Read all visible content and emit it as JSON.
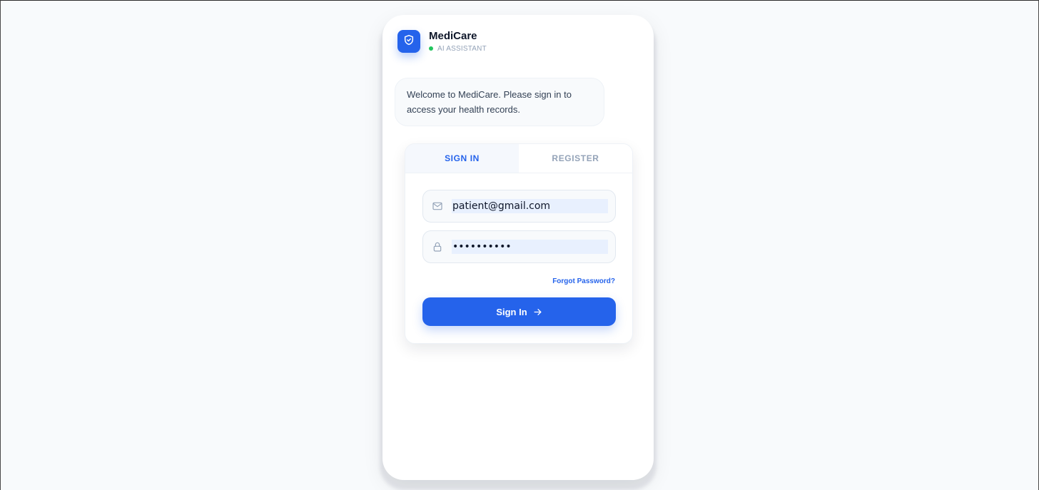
{
  "header": {
    "brand": "MediCare",
    "status": "AI ASSISTANT",
    "logo_icon": "shield-check-icon"
  },
  "welcome": {
    "message": "Welcome to MediCare. Please sign in to access your health records."
  },
  "tabs": [
    {
      "label": "SIGN IN",
      "active": true
    },
    {
      "label": "REGISTER",
      "active": false
    }
  ],
  "form": {
    "email": {
      "value": "patient@gmail.com",
      "icon": "mail-icon"
    },
    "password": {
      "value": "**********",
      "icon": "lock-icon"
    },
    "forgot_label": "Forgot Password?",
    "submit_label": "Sign In",
    "submit_icon": "arrow-right-icon"
  },
  "colors": {
    "accent": "#2563eb",
    "status_online": "#22c55e",
    "page_bg": "#f8fafc"
  }
}
